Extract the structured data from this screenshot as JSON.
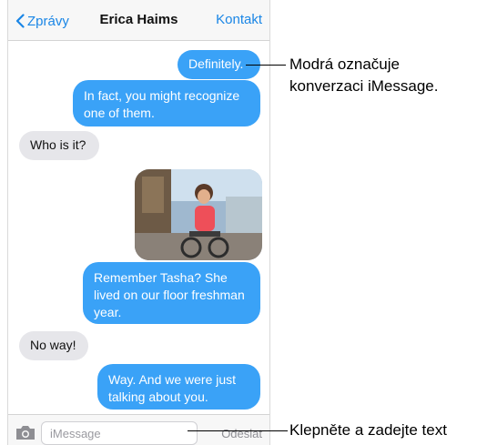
{
  "navbar": {
    "back_label": "Zprávy",
    "title": "Erica Haims",
    "contact_label": "Kontakt"
  },
  "messages": [
    {
      "side": "right",
      "style": "blue",
      "text": "Definitely."
    },
    {
      "side": "right",
      "style": "blue",
      "text": "In fact, you might recognize one of them."
    },
    {
      "side": "left",
      "style": "gray",
      "text": "Who is it?"
    },
    {
      "side": "right",
      "style": "photo",
      "text": ""
    },
    {
      "side": "right",
      "style": "blue",
      "text": "Remember Tasha? She lived on our floor freshman year."
    },
    {
      "side": "left",
      "style": "gray",
      "text": "No way!"
    },
    {
      "side": "right",
      "style": "blue",
      "text": "Way. And we were just talking about you."
    }
  ],
  "input": {
    "placeholder": "iMessage",
    "send_label": "Odeslat"
  },
  "callouts": {
    "blue_note_line1": "Modrá označuje",
    "blue_note_line2": "konverzaci iMessage.",
    "input_note": "Klepněte a zadejte text"
  },
  "colors": {
    "accent": "#1a86e6",
    "imessage_blue": "#3aa2f7",
    "received_gray": "#e6e6ea"
  }
}
